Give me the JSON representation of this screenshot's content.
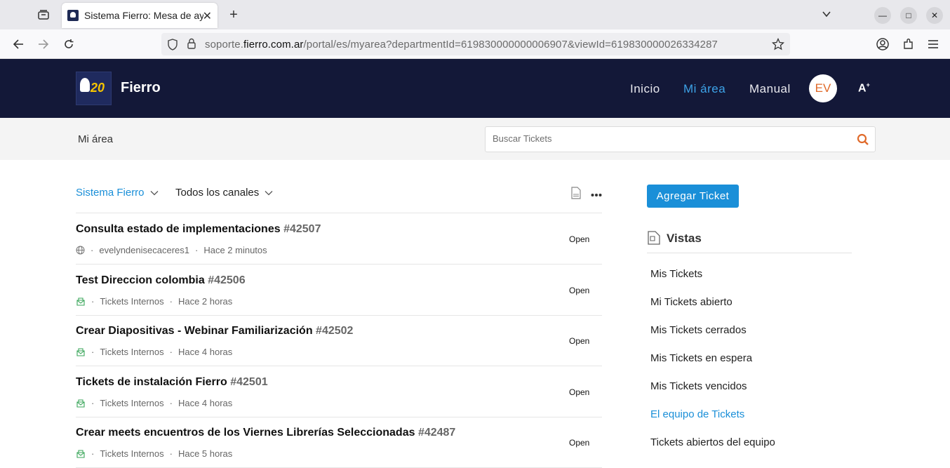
{
  "browser": {
    "tab_title": "Sistema Fierro: Mesa de ayuda",
    "url_prefix": "soporte.",
    "url_domain": "fierro.com.ar",
    "url_path": "/portal/es/myarea?departmentId=619830000000006907&viewId=619830000026334287"
  },
  "header": {
    "brand": "Fierro",
    "logo_text": "20",
    "nav": [
      "Inicio",
      "Mi área",
      "Manual"
    ],
    "avatar": "EV",
    "a11y": "A"
  },
  "subbar": {
    "breadcrumb": "Mi área",
    "search_placeholder": "Buscar Tickets"
  },
  "filters": {
    "department": "Sistema Fierro",
    "channel": "Todos los canales"
  },
  "tickets": [
    {
      "title": "Consulta estado de implementaciones",
      "number": "#42507",
      "source": "evelyndenisecaceres1",
      "time": "Hace 2 minutos",
      "status": "Open",
      "icon": "globe-icon"
    },
    {
      "title": "Test Direccion colombia",
      "number": "#42506",
      "source": "Tickets Internos",
      "time": "Hace 2 horas",
      "status": "Open",
      "icon": "internal-icon"
    },
    {
      "title": "Crear Diapositivas - Webinar Familiarización",
      "number": "#42502",
      "source": "Tickets Internos",
      "time": "Hace 4 horas",
      "status": "Open",
      "icon": "internal-icon"
    },
    {
      "title": "Tickets de instalación Fierro",
      "number": "#42501",
      "source": "Tickets Internos",
      "time": "Hace 4 horas",
      "status": "Open",
      "icon": "internal-icon"
    },
    {
      "title": "Crear meets encuentros de los Viernes Librerías Seleccionadas",
      "number": "#42487",
      "source": "Tickets Internos",
      "time": "Hace 5 horas",
      "status": "Open",
      "icon": "internal-icon"
    }
  ],
  "sidebar": {
    "add_button": "Agregar Ticket",
    "views_title": "Vistas",
    "views": [
      "Mis Tickets",
      "Mi Tickets abierto",
      "Mis Tickets cerrados",
      "Mis Tickets en espera",
      "Mis Tickets vencidos",
      "El equipo de Tickets",
      "Tickets abiertos del equipo"
    ],
    "active_view": "El equipo de Tickets"
  },
  "colors": {
    "header_bg": "#131838",
    "accent": "#1a8fd8",
    "avatar_text": "#e06a2a",
    "search_icon": "#e06a2a"
  }
}
